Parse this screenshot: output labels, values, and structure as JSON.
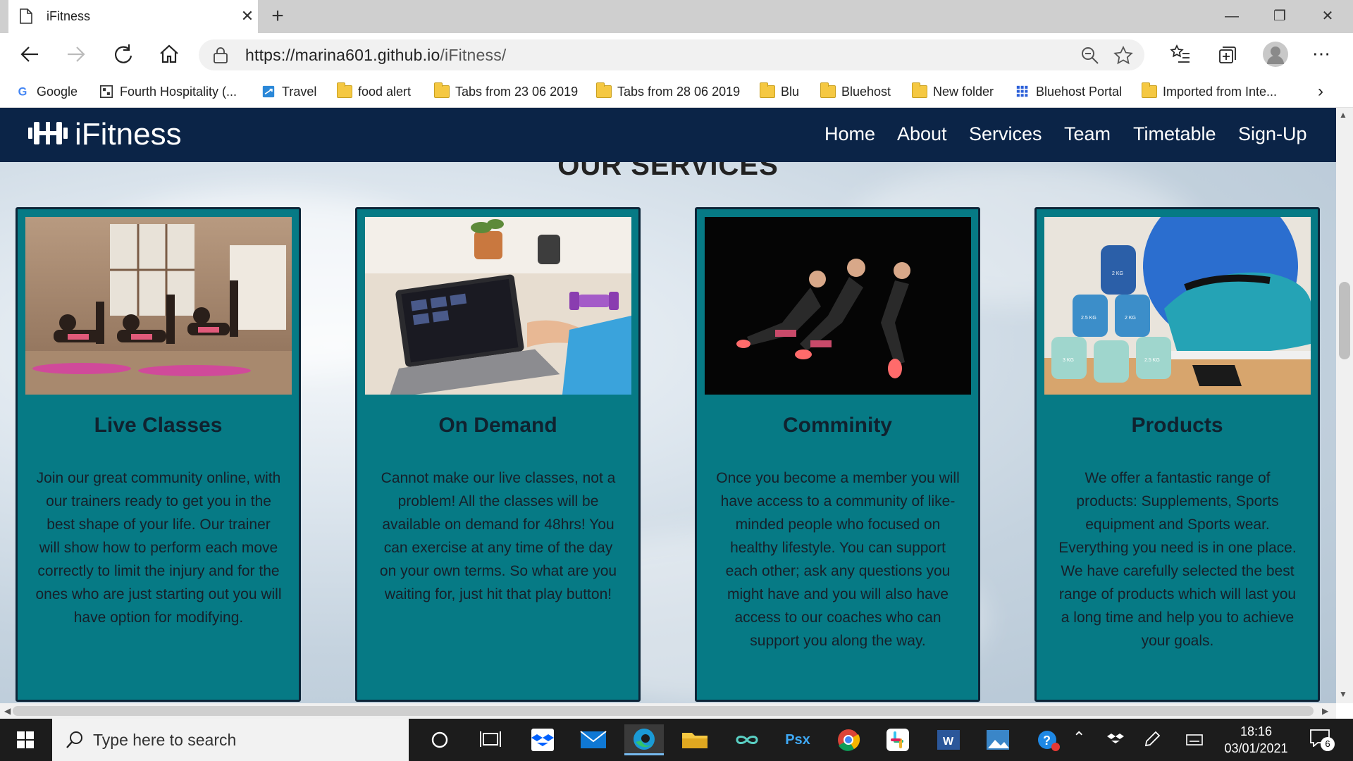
{
  "browser": {
    "tab_title": "iFitness",
    "url_domain": "https://marina601.github.io",
    "url_path": "/iFitness/",
    "bookmarks": [
      {
        "label": "Google",
        "icon": "google-icon"
      },
      {
        "label": "Fourth Hospitality (...",
        "icon": "fourth-icon"
      },
      {
        "label": "Travel",
        "icon": "travel-icon"
      },
      {
        "label": "food alert",
        "icon": "folder-icon"
      },
      {
        "label": "Tabs from 23 06 2019",
        "icon": "folder-icon"
      },
      {
        "label": "Tabs from 28 06 2019",
        "icon": "folder-icon"
      },
      {
        "label": "Blu",
        "icon": "folder-icon"
      },
      {
        "label": "Bluehost",
        "icon": "folder-icon"
      },
      {
        "label": "New folder",
        "icon": "folder-icon"
      },
      {
        "label": "Bluehost Portal",
        "icon": "grid-icon"
      },
      {
        "label": "Imported from Inte...",
        "icon": "folder-icon"
      }
    ]
  },
  "site": {
    "brand": "iFitness",
    "nav": [
      "Home",
      "About",
      "Services",
      "Team",
      "Timetable",
      "Sign-Up"
    ],
    "section_title": "OUR SERVICES",
    "cards": [
      {
        "title": "Live Classes",
        "body": "Join our great community online, with our trainers ready to get you in the best shape of your life. Our trainer will show how to perform each move correctly to limit the injury and for the ones who are just starting out you will have option for modifying."
      },
      {
        "title": "On Demand",
        "body": "Cannot make our live classes, not a problem! All the classes will be available on demand for 48hrs! You can exercise at any time of the day on your own terms. So what are you waiting for, just hit that play button!"
      },
      {
        "title": "Comminity",
        "body": "Once you become a member you will have access to a community of like-minded people who focused on healthy lifestyle. You can support each other; ask any questions you might have and you will also have access to our coaches who can support you along the way."
      },
      {
        "title": "Products",
        "body": "We offer a fantastic range of products: Supplements, Sports equipment and Sports wear. Everything you need is in one place. We have carefully selected the best range of products which will last you a long time and help you to achieve your goals."
      }
    ]
  },
  "taskbar": {
    "search_placeholder": "Type here to search",
    "time": "18:16",
    "date": "03/01/2021",
    "notification_count": "6",
    "dumbbell_labels": [
      "2 KG",
      "2.5 KG",
      "2 KG",
      "3 KG",
      "2.5 KG"
    ]
  },
  "colors": {
    "nav_bg": "#0b2447",
    "card_bg": "#067a85",
    "card_border": "#0d2538"
  }
}
